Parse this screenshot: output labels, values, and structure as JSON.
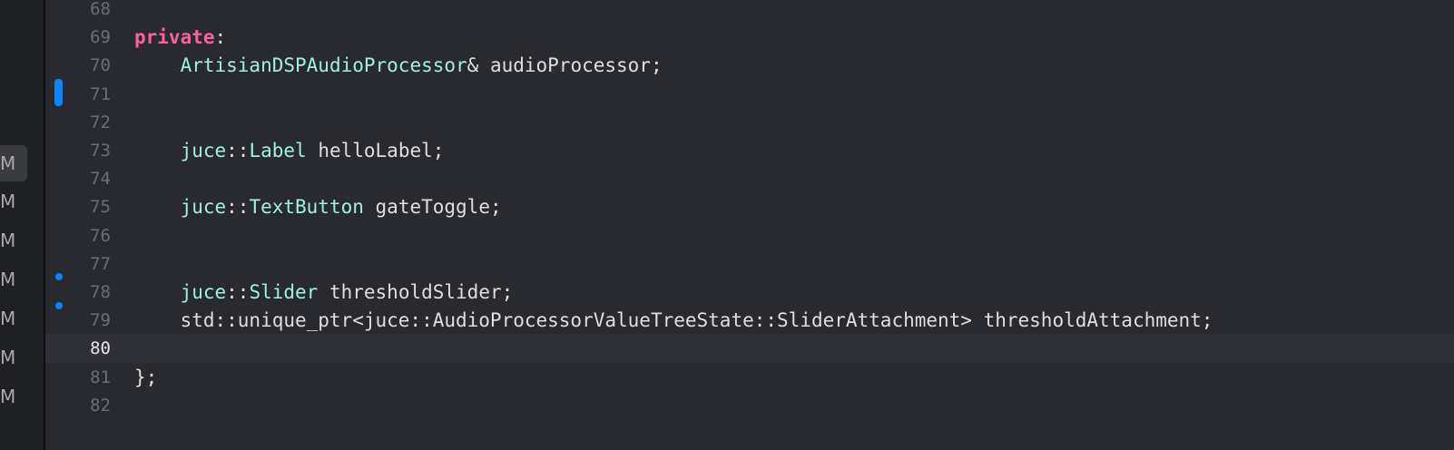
{
  "sidebar": {
    "status_items": [
      "M",
      "M",
      "M",
      "M",
      "M",
      "M",
      "M"
    ]
  },
  "colors": {
    "background": "#292a30",
    "keyword": "#fc5fa3",
    "type": "#9ef1dd",
    "plain": "#dfdfe0",
    "line_number": "#6b6d74",
    "change_marker": "#0b84ff"
  },
  "editor": {
    "current_line": "80",
    "lines": [
      {
        "number": "68",
        "tokens": []
      },
      {
        "number": "69",
        "tokens": [
          {
            "text": "private",
            "kind": "kw"
          },
          {
            "text": ":",
            "kind": "pl"
          }
        ]
      },
      {
        "number": "70",
        "tokens": [
          {
            "text": "    ",
            "kind": "pl"
          },
          {
            "text": "ArtisianDSPAudioProcessor",
            "kind": "ty"
          },
          {
            "text": "& audioProcessor;",
            "kind": "pl"
          }
        ]
      },
      {
        "number": "71",
        "tokens": []
      },
      {
        "number": "72",
        "tokens": []
      },
      {
        "number": "73",
        "tokens": [
          {
            "text": "    ",
            "kind": "pl"
          },
          {
            "text": "juce",
            "kind": "ty"
          },
          {
            "text": "::",
            "kind": "pl"
          },
          {
            "text": "Label",
            "kind": "ty"
          },
          {
            "text": " helloLabel;",
            "kind": "pl"
          }
        ]
      },
      {
        "number": "74",
        "tokens": []
      },
      {
        "number": "75",
        "tokens": [
          {
            "text": "    ",
            "kind": "pl"
          },
          {
            "text": "juce",
            "kind": "ty"
          },
          {
            "text": "::",
            "kind": "pl"
          },
          {
            "text": "TextButton",
            "kind": "ty"
          },
          {
            "text": " gateToggle;",
            "kind": "pl"
          }
        ]
      },
      {
        "number": "76",
        "tokens": []
      },
      {
        "number": "77",
        "tokens": []
      },
      {
        "number": "78",
        "tokens": [
          {
            "text": "    ",
            "kind": "pl"
          },
          {
            "text": "juce",
            "kind": "ty"
          },
          {
            "text": "::",
            "kind": "pl"
          },
          {
            "text": "Slider",
            "kind": "ty"
          },
          {
            "text": " thresholdSlider;",
            "kind": "pl"
          }
        ]
      },
      {
        "number": "79",
        "tokens": [
          {
            "text": "    std::unique_ptr<juce::AudioProcessorValueTreeState::SliderAttachment> thresholdAttachment;",
            "kind": "pl"
          }
        ]
      },
      {
        "number": "80",
        "tokens": []
      },
      {
        "number": "81",
        "tokens": [
          {
            "text": "};",
            "kind": "pl"
          }
        ]
      },
      {
        "number": "82",
        "tokens": []
      }
    ]
  }
}
